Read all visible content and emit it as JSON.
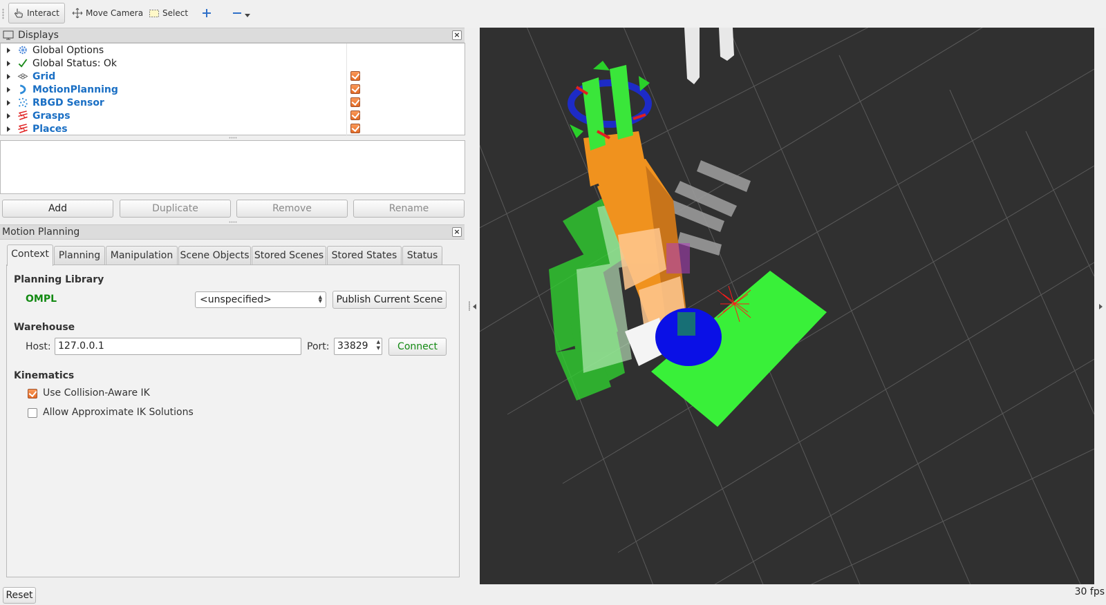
{
  "toolbar": {
    "interact": "Interact",
    "move_camera": "Move Camera",
    "select": "Select"
  },
  "displays": {
    "title": "Displays",
    "close_glyph": "×",
    "items": [
      {
        "label": "Global Options",
        "icon": "gear-icon",
        "checked": null
      },
      {
        "label": "Global Status: Ok",
        "icon": "checkmark-icon",
        "checked": null
      },
      {
        "label": "Grid",
        "icon": "grid-icon",
        "checked": true
      },
      {
        "label": "MotionPlanning",
        "icon": "motion-planning-icon",
        "checked": true
      },
      {
        "label": "RBGD Sensor",
        "icon": "point-cloud-icon",
        "checked": true
      },
      {
        "label": "Grasps",
        "icon": "marker-array-icon",
        "checked": true
      },
      {
        "label": "Places",
        "icon": "marker-array-icon",
        "checked": true
      }
    ],
    "buttons": {
      "add": "Add",
      "duplicate": "Duplicate",
      "remove": "Remove",
      "rename": "Rename"
    }
  },
  "motion_planning": {
    "title": "Motion Planning",
    "close_glyph": "×",
    "tabs": [
      {
        "label": "Context",
        "active": true
      },
      {
        "label": "Planning",
        "active": false
      },
      {
        "label": "Manipulation",
        "active": false
      },
      {
        "label": "Scene Objects",
        "active": false
      },
      {
        "label": "Stored Scenes",
        "active": false
      },
      {
        "label": "Stored States",
        "active": false
      },
      {
        "label": "Status",
        "active": false
      }
    ],
    "context": {
      "planning_library_heading": "Planning Library",
      "library_name": "OMPL",
      "planner_selected": "<unspecified>",
      "publish_button": "Publish Current Scene",
      "warehouse_heading": "Warehouse",
      "host_label": "Host:",
      "host_value": "127.0.0.1",
      "port_label": "Port:",
      "port_value": "33829",
      "connect_button": "Connect",
      "kinematics_heading": "Kinematics",
      "collision_aware_ik": {
        "label": "Use Collision-Aware IK",
        "checked": true
      },
      "approx_ik": {
        "label": "Allow Approximate IK Solutions",
        "checked": false
      }
    }
  },
  "bottom": {
    "reset_button": "Reset",
    "fps": "30 fps"
  },
  "colors": {
    "viewport_bg": "#303030",
    "link_blue": "#1a6fc4",
    "ompl_green": "#138a13",
    "connect_green": "#138a13",
    "robot_orange": "#f0921e",
    "table_green": "#3cf03c",
    "object_blue": "#0a10e6"
  }
}
